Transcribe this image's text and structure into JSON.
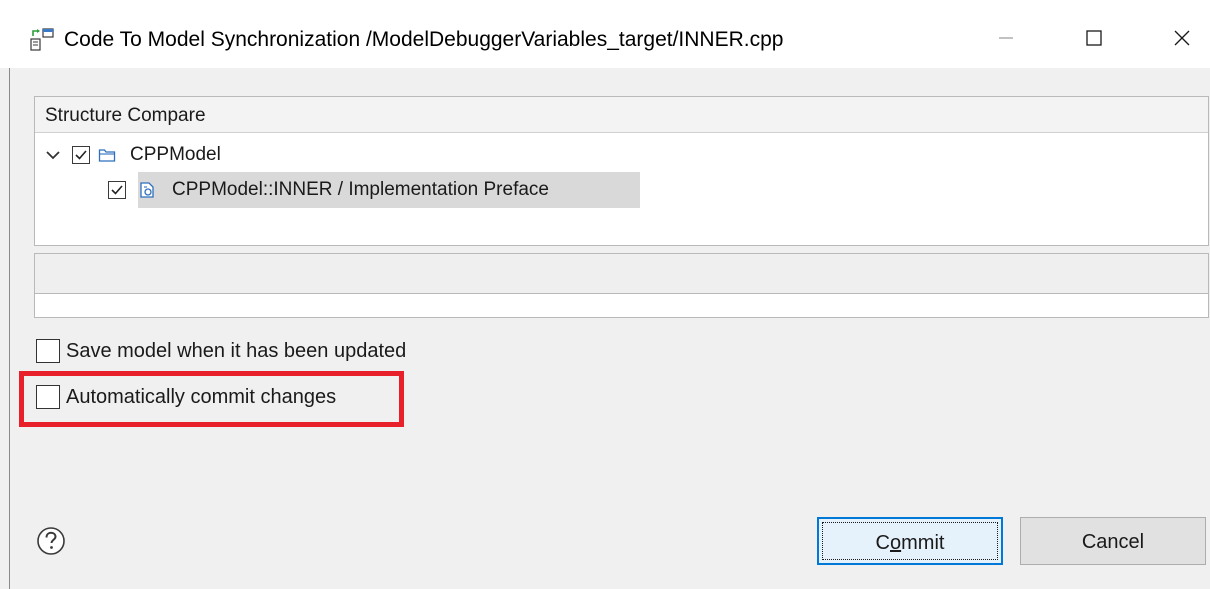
{
  "window": {
    "title": "Code To Model Synchronization /ModelDebuggerVariables_target/INNER.cpp",
    "controls": [
      "minimize",
      "maximize",
      "close"
    ]
  },
  "structure_compare": {
    "header": "Structure Compare",
    "tree": [
      {
        "label": "CPPModel",
        "checked": true,
        "expanded": true,
        "icon": "folder-icon",
        "children": [
          {
            "label": "CPPModel::INNER / Implementation Preface",
            "checked": true,
            "selected": true,
            "icon": "class-file-icon"
          }
        ]
      }
    ]
  },
  "options": {
    "save_model": {
      "label": "Save model when it has been updated",
      "checked": false
    },
    "auto_commit": {
      "label": "Automatically commit changes",
      "checked": false,
      "highlighted": true,
      "highlight_color": "#e8202a"
    }
  },
  "footer": {
    "help_icon": "help-icon",
    "commit_prefix": "C",
    "commit_mnemonic": "o",
    "commit_suffix": "mmit",
    "cancel_label": "Cancel"
  },
  "colors": {
    "dialog_bg": "#f0f0f0",
    "selection_bg": "#d9d9d9",
    "default_button_border": "#0078d7",
    "icon_blue": "#2f6fbf"
  }
}
